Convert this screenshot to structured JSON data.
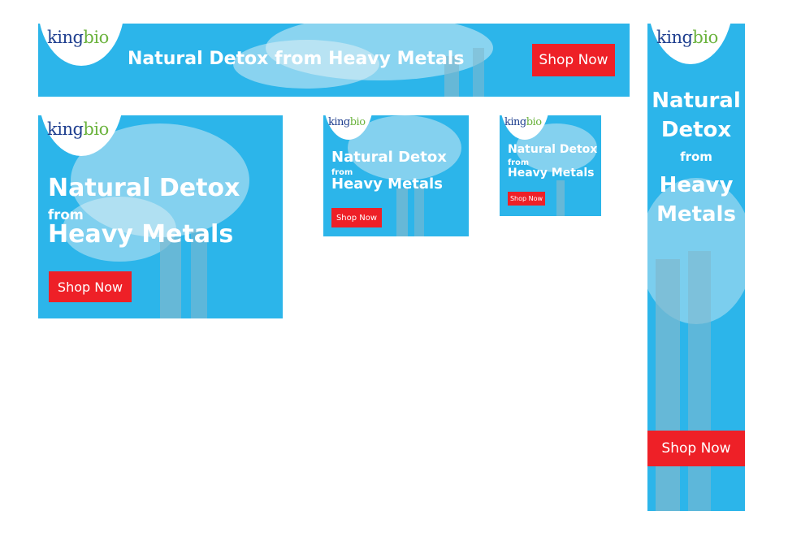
{
  "brand": {
    "logo_king": "king",
    "logo_bio": "bio",
    "logo_alt": "kingbio"
  },
  "headline": {
    "natural_detox": "Natural Detox",
    "natural": "Natural",
    "detox": "Detox",
    "from": "from",
    "heavy_metals": "Heavy Metals",
    "heavy": "Heavy",
    "metals": "Metals",
    "full": "Natural Detox from Heavy Metals"
  },
  "cta": {
    "label": "Shop Now"
  },
  "colors": {
    "banner_blue": "#2cb5ea",
    "cta_red": "#ee2027",
    "logo_navy": "#1f3f8f",
    "logo_green": "#6bb33d"
  }
}
